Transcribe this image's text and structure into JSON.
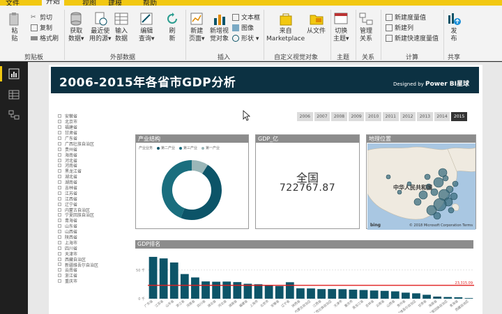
{
  "menu": {
    "tabs": [
      "文件",
      "开始",
      "视图",
      "建模",
      "帮助"
    ],
    "active": "开始"
  },
  "ribbon": {
    "clipboard": {
      "paste": "粘\n贴",
      "cut": "剪切",
      "copy": "复制",
      "format": "格式刷",
      "label": "剪贴板"
    },
    "external": {
      "get_data": "获取\n数据▾",
      "recent": "最近使\n用的源▾",
      "enter": "输入\n数据",
      "edit": "编辑\n查询▾",
      "refresh": "刷\n新",
      "label": "外部数据"
    },
    "insert": {
      "new_page": "新建\n页面▾",
      "new_visual": "新增视\n觉对象",
      "textbox": "文本框",
      "image": "图像",
      "shape": "形状 ▾",
      "label": "插入"
    },
    "custom": {
      "marketplace": "来自\nMarketplace",
      "from_file": "从文件",
      "label": "自定义视觉对象"
    },
    "theme": {
      "switch": "切换\n主题▾",
      "label": "主题"
    },
    "relations": {
      "manage": "管理\n关系",
      "label": "关系"
    },
    "calc": {
      "measure": "新建度量值",
      "column": "新建列",
      "quick": "新建快速度量值",
      "label": "计算"
    },
    "share": {
      "publish": "发\n布",
      "label": "共享"
    }
  },
  "report": {
    "title": "2006-2015年各省市GDP分析",
    "designed_by": "Designed by",
    "brand": "Power BI星球",
    "provinces": [
      "安徽省",
      "北京市",
      "福建省",
      "甘肃省",
      "广东省",
      "广西壮族自治区",
      "贵州省",
      "海南省",
      "河北省",
      "河南省",
      "黑龙江省",
      "湖北省",
      "湖南省",
      "吉林省",
      "江苏省",
      "江西省",
      "辽宁省",
      "内蒙古自治区",
      "宁夏回族自治区",
      "青海省",
      "山东省",
      "山西省",
      "陕西省",
      "上海市",
      "四川省",
      "天津市",
      "西藏自治区",
      "新疆维吾尔自治区",
      "云南省",
      "浙江省",
      "重庆市"
    ],
    "years": [
      "2006",
      "2007",
      "2008",
      "2009",
      "2010",
      "2011",
      "2012",
      "2013",
      "2014",
      "2015"
    ],
    "selected_year": "2015",
    "structure": {
      "title": "产业结构",
      "legend_title": "产业业务",
      "legend": [
        "第二产业",
        "第三产业",
        "第一产业"
      ],
      "colors": [
        "#0c5468",
        "#1a6e7e",
        "#9ab6b8"
      ]
    },
    "kpi": {
      "title": "GDP_亿",
      "label": "全国",
      "value": "722767.87"
    },
    "map": {
      "title": "地理位置",
      "country": "中华人民共和国",
      "bing": "bing",
      "copyright": "© 2018 Microsoft Corporation Terms"
    }
  },
  "chart_data": [
    {
      "type": "pie",
      "title": "产业结构",
      "categories": [
        "第二产业",
        "第三产业",
        "第一产业"
      ],
      "values": [
        47,
        44,
        9
      ]
    },
    {
      "type": "bar",
      "title": "GDP排名",
      "categories": [
        "广东省",
        "江苏省",
        "山东省",
        "浙江省",
        "河南省",
        "四川省",
        "湖北省",
        "河北省",
        "湖南省",
        "福建省",
        "上海市",
        "北京市",
        "安徽省",
        "辽宁省",
        "陕西省",
        "内蒙古自治区",
        "江西省",
        "广西壮族自治区",
        "天津市",
        "重庆市",
        "黑龙江省",
        "吉林省",
        "云南省",
        "山西省",
        "贵州省",
        "新疆维吾尔自治区",
        "甘肃省",
        "海南省",
        "宁夏回族自治区",
        "青海省",
        "西藏自治区"
      ],
      "values": [
        72813,
        70116,
        63002,
        42886,
        37002,
        30053,
        29550,
        29806,
        28902,
        25980,
        25123,
        23015,
        22006,
        28669,
        18022,
        17832,
        16724,
        16803,
        16538,
        15717,
        15084,
        14274,
        13619,
        12766,
        10503,
        9325,
        6790,
        3703,
        2912,
        2417,
        1026
      ],
      "reference_line": {
        "value": 23315.09,
        "label": "23,315.09"
      },
      "ytick_labels": [
        "0 千",
        "50 千"
      ],
      "yticks": [
        0,
        50000
      ],
      "ylim": [
        0,
        80000
      ],
      "bar_color": "#0c5468",
      "line_color": "#e01e1e"
    }
  ]
}
